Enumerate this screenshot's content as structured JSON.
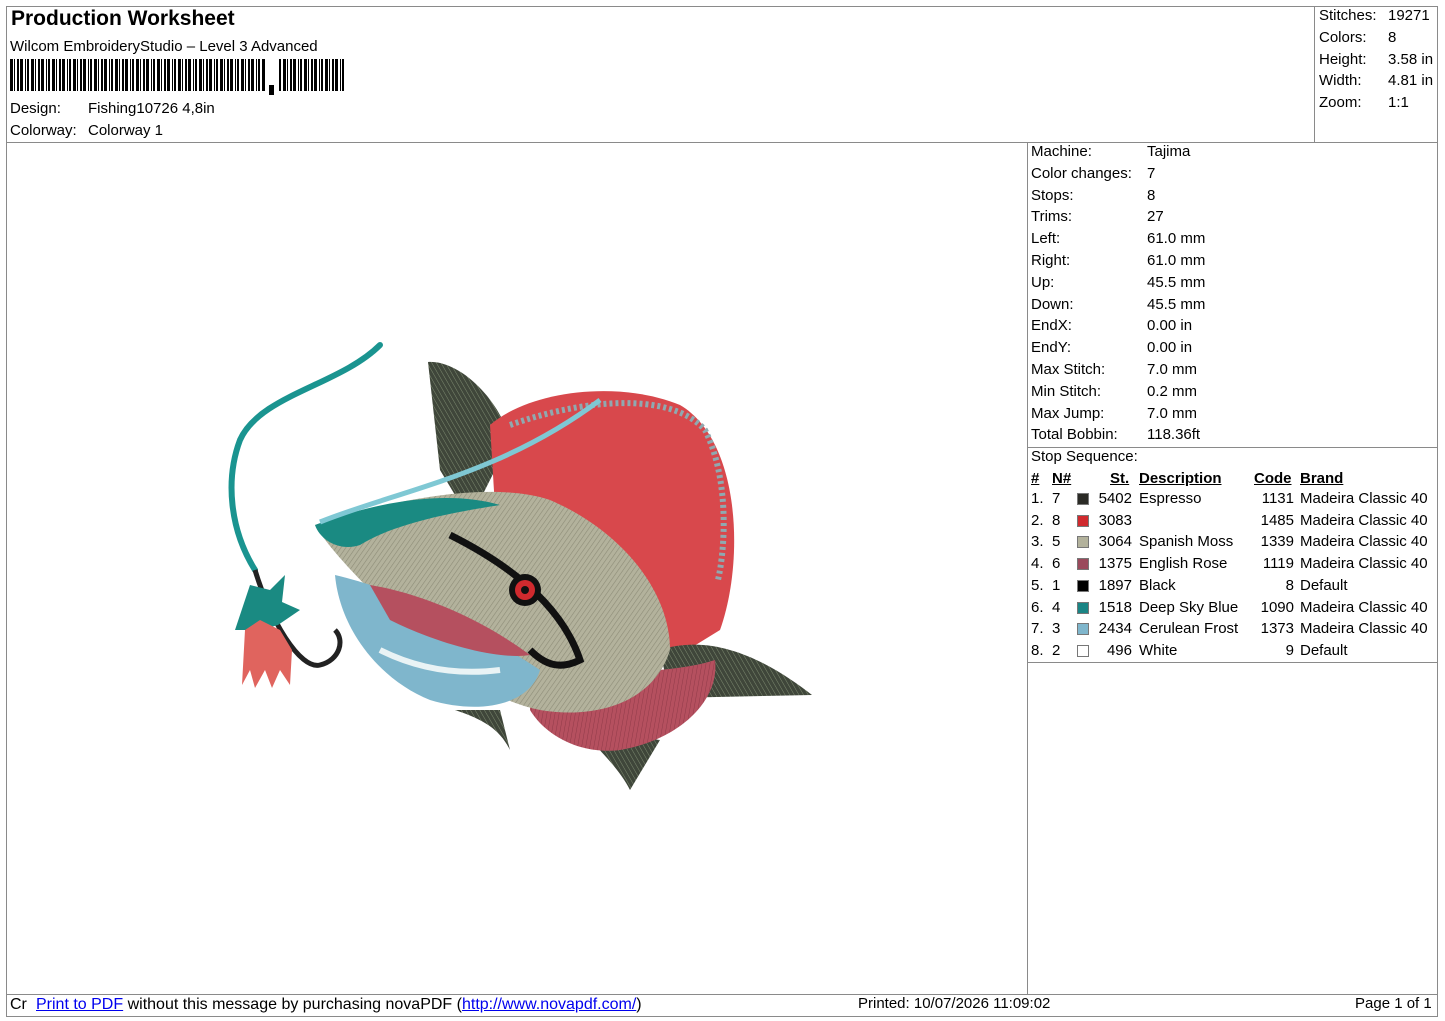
{
  "header": {
    "title": "Production Worksheet",
    "software": "Wilcom EmbroideryStudio – Level 3 Advanced",
    "design_label": "Design:",
    "design_value": "Fishing10726 4,8in",
    "colorway_label": "Colorway:",
    "colorway_value": "Colorway 1"
  },
  "stats": [
    {
      "label": "Stitches:",
      "value": "19271"
    },
    {
      "label": "Colors:",
      "value": "8"
    },
    {
      "label": "Height:",
      "value": "3.58 in"
    },
    {
      "label": "Width:",
      "value": "4.81 in"
    },
    {
      "label": "Zoom:",
      "value": "1:1"
    }
  ],
  "machine": [
    {
      "label": "Machine:",
      "value": "Tajima"
    },
    {
      "label": "Color changes:",
      "value": "7"
    },
    {
      "label": "Stops:",
      "value": "8"
    },
    {
      "label": "Trims:",
      "value": "27"
    },
    {
      "label": "Left:",
      "value": "61.0 mm"
    },
    {
      "label": "Right:",
      "value": "61.0 mm"
    },
    {
      "label": "Up:",
      "value": "45.5 mm"
    },
    {
      "label": "Down:",
      "value": "45.5 mm"
    },
    {
      "label": "EndX:",
      "value": "0.00 in"
    },
    {
      "label": "EndY:",
      "value": "0.00 in"
    },
    {
      "label": "Max Stitch:",
      "value": "7.0 mm"
    },
    {
      "label": "Min Stitch:",
      "value": "0.2 mm"
    },
    {
      "label": "Max Jump:",
      "value": "7.0 mm"
    },
    {
      "label": "Total Bobbin:",
      "value": "118.36ft"
    }
  ],
  "sequence": {
    "title": "Stop Sequence:",
    "headers": {
      "num": "#",
      "n": "N#",
      "st": "St.",
      "desc": "Description",
      "code": "Code",
      "brand": "Brand"
    },
    "rows": [
      {
        "num": "1.",
        "n": "7",
        "color": "#2b2b26",
        "st": "5402",
        "desc": "Espresso",
        "code": "1131",
        "brand": "Madeira Classic 40"
      },
      {
        "num": "2.",
        "n": "8",
        "color": "#d02a2e",
        "st": "3083",
        "desc": "",
        "code": "1485",
        "brand": "Madeira Classic 40"
      },
      {
        "num": "3.",
        "n": "5",
        "color": "#b3b29c",
        "st": "3064",
        "desc": "Spanish Moss",
        "code": "1339",
        "brand": "Madeira Classic 40"
      },
      {
        "num": "4.",
        "n": "6",
        "color": "#9a4a5c",
        "st": "1375",
        "desc": "English Rose",
        "code": "1119",
        "brand": "Madeira Classic 40"
      },
      {
        "num": "5.",
        "n": "1",
        "color": "#000000",
        "st": "1897",
        "desc": "Black",
        "code": "8",
        "brand": "Default"
      },
      {
        "num": "6.",
        "n": "4",
        "color": "#1a8585",
        "st": "1518",
        "desc": "Deep Sky Blue",
        "code": "1090",
        "brand": "Madeira Classic 40"
      },
      {
        "num": "7.",
        "n": "3",
        "color": "#7fb6cc",
        "st": "2434",
        "desc": "Cerulean Frost",
        "code": "1373",
        "brand": "Madeira Classic 40"
      },
      {
        "num": "8.",
        "n": "2",
        "color": "#ffffff",
        "st": "496",
        "desc": "White",
        "code": "9",
        "brand": "Default"
      }
    ]
  },
  "footer": {
    "prefix": "Cr",
    "link1": "Print to PDF",
    "middle": " without this message by purchasing novaPDF (",
    "link2": "http://www.novapdf.com/",
    "suffix": ")",
    "printed": "Printed: 10/07/2026 11:09:02",
    "page": "Page 1 of 1"
  }
}
